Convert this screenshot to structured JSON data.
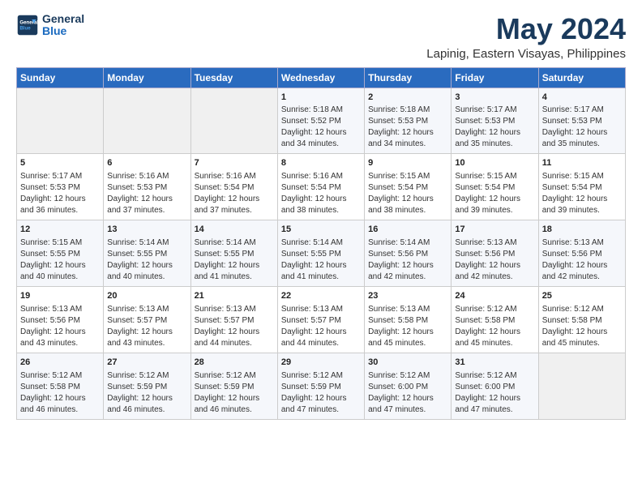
{
  "brand": {
    "line1": "General",
    "line2": "Blue"
  },
  "title": "May 2024",
  "subtitle": "Lapinig, Eastern Visayas, Philippines",
  "header_days": [
    "Sunday",
    "Monday",
    "Tuesday",
    "Wednesday",
    "Thursday",
    "Friday",
    "Saturday"
  ],
  "weeks": [
    [
      {
        "day": "",
        "content": ""
      },
      {
        "day": "",
        "content": ""
      },
      {
        "day": "",
        "content": ""
      },
      {
        "day": "1",
        "content": "Sunrise: 5:18 AM\nSunset: 5:52 PM\nDaylight: 12 hours\nand 34 minutes."
      },
      {
        "day": "2",
        "content": "Sunrise: 5:18 AM\nSunset: 5:53 PM\nDaylight: 12 hours\nand 34 minutes."
      },
      {
        "day": "3",
        "content": "Sunrise: 5:17 AM\nSunset: 5:53 PM\nDaylight: 12 hours\nand 35 minutes."
      },
      {
        "day": "4",
        "content": "Sunrise: 5:17 AM\nSunset: 5:53 PM\nDaylight: 12 hours\nand 35 minutes."
      }
    ],
    [
      {
        "day": "5",
        "content": "Sunrise: 5:17 AM\nSunset: 5:53 PM\nDaylight: 12 hours\nand 36 minutes."
      },
      {
        "day": "6",
        "content": "Sunrise: 5:16 AM\nSunset: 5:53 PM\nDaylight: 12 hours\nand 37 minutes."
      },
      {
        "day": "7",
        "content": "Sunrise: 5:16 AM\nSunset: 5:54 PM\nDaylight: 12 hours\nand 37 minutes."
      },
      {
        "day": "8",
        "content": "Sunrise: 5:16 AM\nSunset: 5:54 PM\nDaylight: 12 hours\nand 38 minutes."
      },
      {
        "day": "9",
        "content": "Sunrise: 5:15 AM\nSunset: 5:54 PM\nDaylight: 12 hours\nand 38 minutes."
      },
      {
        "day": "10",
        "content": "Sunrise: 5:15 AM\nSunset: 5:54 PM\nDaylight: 12 hours\nand 39 minutes."
      },
      {
        "day": "11",
        "content": "Sunrise: 5:15 AM\nSunset: 5:54 PM\nDaylight: 12 hours\nand 39 minutes."
      }
    ],
    [
      {
        "day": "12",
        "content": "Sunrise: 5:15 AM\nSunset: 5:55 PM\nDaylight: 12 hours\nand 40 minutes."
      },
      {
        "day": "13",
        "content": "Sunrise: 5:14 AM\nSunset: 5:55 PM\nDaylight: 12 hours\nand 40 minutes."
      },
      {
        "day": "14",
        "content": "Sunrise: 5:14 AM\nSunset: 5:55 PM\nDaylight: 12 hours\nand 41 minutes."
      },
      {
        "day": "15",
        "content": "Sunrise: 5:14 AM\nSunset: 5:55 PM\nDaylight: 12 hours\nand 41 minutes."
      },
      {
        "day": "16",
        "content": "Sunrise: 5:14 AM\nSunset: 5:56 PM\nDaylight: 12 hours\nand 42 minutes."
      },
      {
        "day": "17",
        "content": "Sunrise: 5:13 AM\nSunset: 5:56 PM\nDaylight: 12 hours\nand 42 minutes."
      },
      {
        "day": "18",
        "content": "Sunrise: 5:13 AM\nSunset: 5:56 PM\nDaylight: 12 hours\nand 42 minutes."
      }
    ],
    [
      {
        "day": "19",
        "content": "Sunrise: 5:13 AM\nSunset: 5:56 PM\nDaylight: 12 hours\nand 43 minutes."
      },
      {
        "day": "20",
        "content": "Sunrise: 5:13 AM\nSunset: 5:57 PM\nDaylight: 12 hours\nand 43 minutes."
      },
      {
        "day": "21",
        "content": "Sunrise: 5:13 AM\nSunset: 5:57 PM\nDaylight: 12 hours\nand 44 minutes."
      },
      {
        "day": "22",
        "content": "Sunrise: 5:13 AM\nSunset: 5:57 PM\nDaylight: 12 hours\nand 44 minutes."
      },
      {
        "day": "23",
        "content": "Sunrise: 5:13 AM\nSunset: 5:58 PM\nDaylight: 12 hours\nand 45 minutes."
      },
      {
        "day": "24",
        "content": "Sunrise: 5:12 AM\nSunset: 5:58 PM\nDaylight: 12 hours\nand 45 minutes."
      },
      {
        "day": "25",
        "content": "Sunrise: 5:12 AM\nSunset: 5:58 PM\nDaylight: 12 hours\nand 45 minutes."
      }
    ],
    [
      {
        "day": "26",
        "content": "Sunrise: 5:12 AM\nSunset: 5:58 PM\nDaylight: 12 hours\nand 46 minutes."
      },
      {
        "day": "27",
        "content": "Sunrise: 5:12 AM\nSunset: 5:59 PM\nDaylight: 12 hours\nand 46 minutes."
      },
      {
        "day": "28",
        "content": "Sunrise: 5:12 AM\nSunset: 5:59 PM\nDaylight: 12 hours\nand 46 minutes."
      },
      {
        "day": "29",
        "content": "Sunrise: 5:12 AM\nSunset: 5:59 PM\nDaylight: 12 hours\nand 47 minutes."
      },
      {
        "day": "30",
        "content": "Sunrise: 5:12 AM\nSunset: 6:00 PM\nDaylight: 12 hours\nand 47 minutes."
      },
      {
        "day": "31",
        "content": "Sunrise: 5:12 AM\nSunset: 6:00 PM\nDaylight: 12 hours\nand 47 minutes."
      },
      {
        "day": "",
        "content": ""
      }
    ]
  ]
}
